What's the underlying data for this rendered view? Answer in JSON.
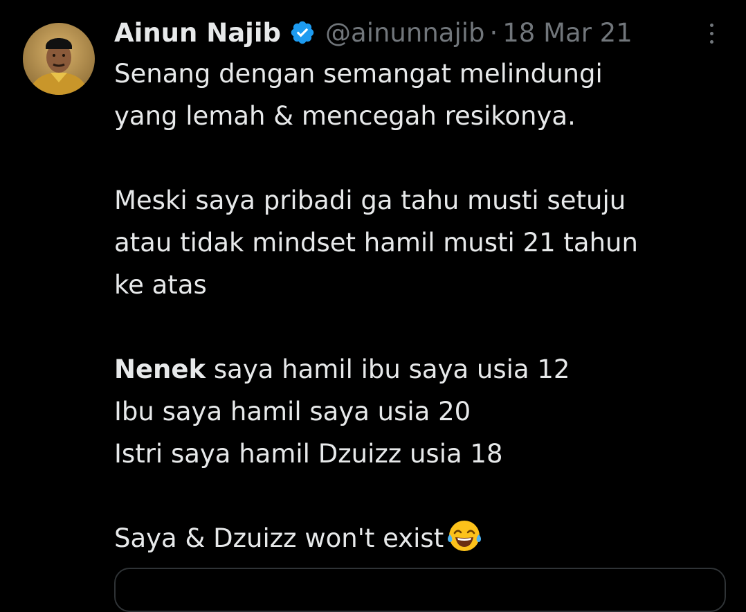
{
  "tweet": {
    "author_name": "Ainun Najib",
    "handle": "@ainunnajib",
    "separator": "·",
    "date": "18 Mar 21",
    "lines": {
      "l1": "Senang dengan semangat melindungi",
      "l2": "yang lemah & mencegah resikonya.",
      "l3": "Meski saya pribadi ga tahu musti setuju",
      "l4": "atau tidak mindset hamil musti 21 tahun",
      "l5": "ke atas",
      "l6_bold": "Nenek",
      "l6_rest": " saya hamil ibu saya usia 12",
      "l7": "Ibu saya hamil saya usia 20",
      "l8": "Istri saya hamil Dzuizz usia 18",
      "l9": "Saya & Dzuizz won't exist"
    },
    "emoji": "face-with-tears-of-joy",
    "icons": {
      "verified": "verified-badge-icon",
      "more": "more-options-icon"
    },
    "colors": {
      "background": "#000000",
      "text": "#e7e9ea",
      "secondary": "#71767b",
      "verified": "#1d9bf0"
    }
  }
}
